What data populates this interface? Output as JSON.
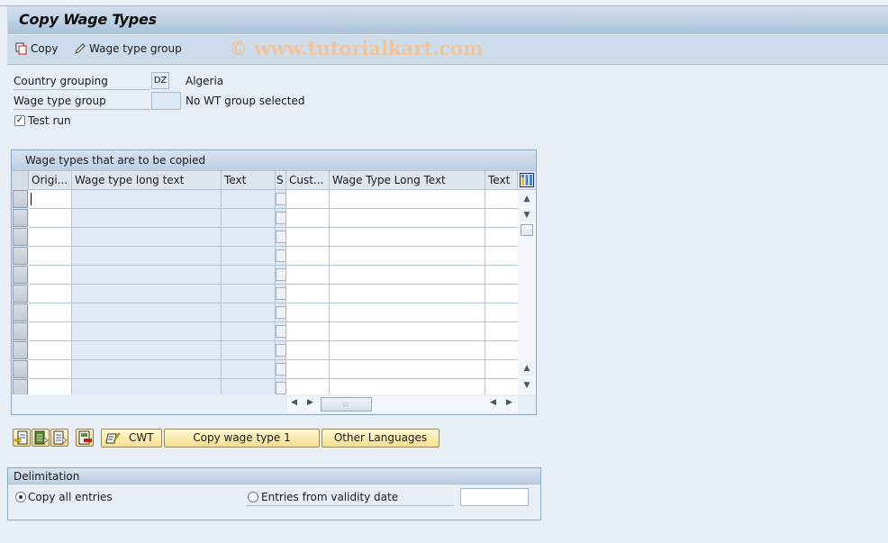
{
  "window": {
    "title": "Copy Wage Types"
  },
  "toolbar": {
    "copy_label": "Copy",
    "wage_type_group_label": "Wage type group",
    "watermark": "© www.tutorialkart.com"
  },
  "form": {
    "country_grouping": {
      "label": "Country grouping",
      "value": "DZ",
      "description": "Algeria"
    },
    "wage_type_group": {
      "label": "Wage type group",
      "value": "",
      "description": "No WT group selected"
    },
    "test_run": {
      "label": "Test run",
      "checked": true,
      "mark": "✓"
    }
  },
  "grid": {
    "title": "Wage types that are to be copied",
    "columns": [
      "Origi...",
      "Wage type long text",
      "Text",
      "S",
      "Cust...",
      "Wage Type Long Text",
      "Text"
    ],
    "row_count": 11,
    "rows": []
  },
  "actions": {
    "cwt_label": "CWT",
    "copy_wage_type_label": "Copy wage type 1",
    "other_languages_label": "Other Languages"
  },
  "delimitation": {
    "title": "Delimitation",
    "options": [
      {
        "label": "Copy all entries",
        "selected": true
      },
      {
        "label": "Entries from validity date",
        "selected": false
      }
    ],
    "validity_date": ""
  }
}
